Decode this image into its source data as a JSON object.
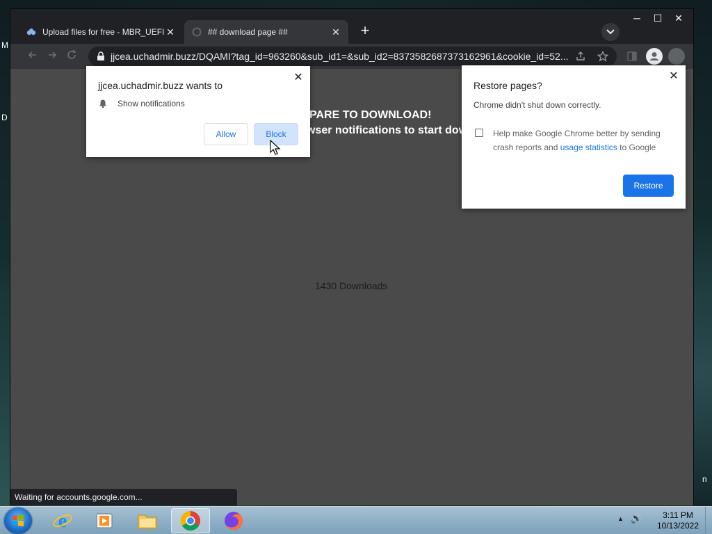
{
  "desktop": {
    "edge_letters": [
      "M",
      "D",
      "n"
    ]
  },
  "window": {
    "controls": [
      "─",
      "☐",
      "✕"
    ]
  },
  "tabs": [
    {
      "title": "Upload files for free - MBR_UEFI...",
      "active": false,
      "close": "✕"
    },
    {
      "title": "## download page ##",
      "active": true,
      "close": "✕"
    }
  ],
  "newtab_label": "+",
  "toolbar": {
    "url": "jjcea.uchadmir.buzz/DQAMI?tag_id=963260&sub_id1=&sub_id2=8373582687373162961&cookie_id=52..."
  },
  "page": {
    "headline": "PARE TO DOWNLOAD!",
    "subline": "wser notifications to start dow",
    "downloads": "1430 Downloads"
  },
  "notification_prompt": {
    "site": "jjcea.uchadmir.buzz wants to",
    "permission": "Show notifications",
    "allow_label": "Allow",
    "block_label": "Block",
    "close": "✕"
  },
  "restore_prompt": {
    "title": "Restore pages?",
    "message": "Chrome didn't shut down correctly.",
    "checkbox_text_before": "Help make Google Chrome better by sending crash reports and",
    "checkbox_link": "usage statistics",
    "checkbox_text_after": "to Google",
    "checked": false,
    "restore_label": "Restore",
    "close": "✕"
  },
  "status_text": "Waiting for accounts.google.com...",
  "taskbar": {
    "items": [
      "internet-explorer",
      "media-player",
      "file-explorer",
      "chrome",
      "firefox"
    ],
    "active": "chrome",
    "tray": {
      "arrow": "▲",
      "volume": "🔊"
    },
    "time": "3:11 PM",
    "date": "10/13/2022"
  }
}
